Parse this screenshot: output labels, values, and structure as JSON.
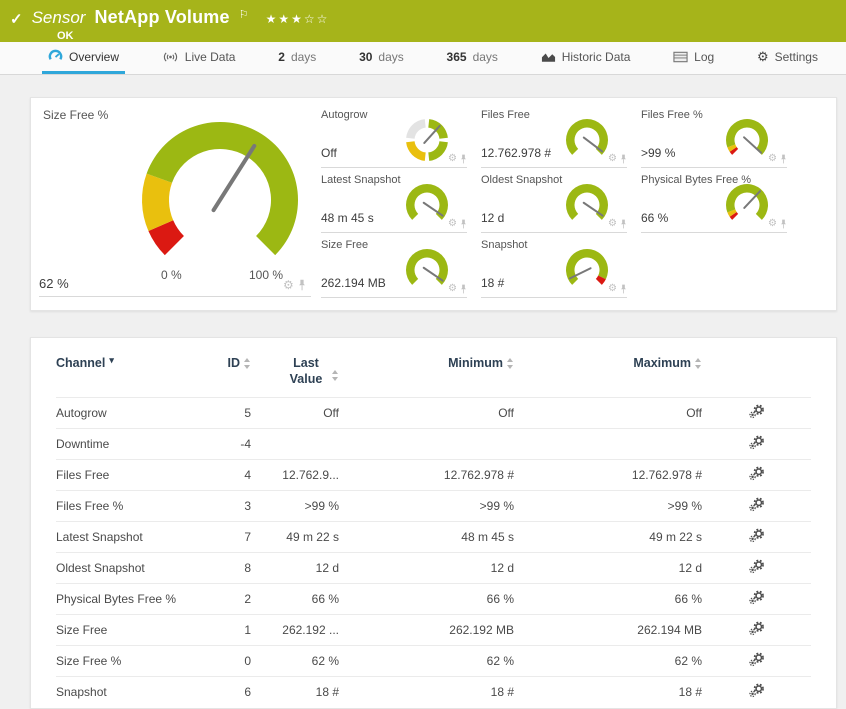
{
  "header": {
    "kind_label": "Sensor",
    "title": "NetApp Volume",
    "status": "OK",
    "stars": "★★★☆☆",
    "colors": {
      "header_bg": "#a6b41a"
    }
  },
  "icons": {
    "check": "✓",
    "flag": "⚐",
    "gear": "⚙",
    "caret_down": "▾"
  },
  "tabs": [
    {
      "label": "Overview",
      "active": true
    },
    {
      "label": "Live Data"
    },
    {
      "num": "2",
      "word": "days"
    },
    {
      "num": "30",
      "word": "days"
    },
    {
      "num": "365",
      "word": "days"
    },
    {
      "label": "Historic Data"
    },
    {
      "label": "Log"
    },
    {
      "label": "Settings"
    }
  ],
  "colors": {
    "gauge_green": "#9cb813",
    "gauge_yellow": "#e9c00e",
    "gauge_red": "#db1912",
    "active_tab_blue": "#2fa7da",
    "table_header_text": "#2e4154"
  },
  "chart_data": {
    "type": "gauges",
    "main_gauge": {
      "label": "Size Free %",
      "value": "62 %",
      "scale_min": "0 %",
      "scale_max": "100 %",
      "percent": 62,
      "segments": [
        {
          "from": 0,
          "to": 8,
          "color": "#db1912"
        },
        {
          "from": 8,
          "to": 24,
          "color": "#e9c00e"
        },
        {
          "from": 24,
          "to": 100,
          "color": "#9cb813"
        }
      ]
    },
    "tiles": [
      {
        "label": "Autogrow",
        "value": "Off",
        "gauge": {
          "needle_deg": 48,
          "deg_segments": [
            {
              "a1": 174,
              "a2": 96,
              "color": "#e3e3e3"
            },
            {
              "a1": 264,
              "a2": 186,
              "color": "#e9c00e"
            },
            {
              "a1": 354,
              "a2": 276,
              "color": "#9cb813"
            },
            {
              "a1": 84,
              "a2": 6,
              "color": "#9cb813"
            }
          ]
        }
      },
      {
        "label": "Files Free",
        "value": "12.762.978 #",
        "gauge": {
          "percent": 97,
          "segments": [
            {
              "from": 0,
              "to": 100,
              "color": "#9cb813"
            }
          ]
        }
      },
      {
        "label": "Files Free %",
        "value": ">99 %",
        "gauge": {
          "percent": 99,
          "segments": [
            {
              "from": 0,
              "to": 4,
              "color": "#db1912"
            },
            {
              "from": 4,
              "to": 9,
              "color": "#e9c00e"
            },
            {
              "from": 9,
              "to": 100,
              "color": "#9cb813"
            }
          ]
        }
      },
      {
        "label": "Latest Snapshot",
        "value": "48 m 45 s",
        "gauge": {
          "percent": 96,
          "segments": [
            {
              "from": 0,
              "to": 100,
              "color": "#9cb813"
            }
          ]
        }
      },
      {
        "label": "Oldest Snapshot",
        "value": "12 d",
        "gauge": {
          "percent": 96,
          "segments": [
            {
              "from": 0,
              "to": 100,
              "color": "#9cb813"
            }
          ]
        }
      },
      {
        "label": "Physical Bytes Free %",
        "value": "66 %",
        "gauge": {
          "percent": 66,
          "segments": [
            {
              "from": 0,
              "to": 4,
              "color": "#db1912"
            },
            {
              "from": 4,
              "to": 9,
              "color": "#e9c00e"
            },
            {
              "from": 9,
              "to": 100,
              "color": "#9cb813"
            }
          ]
        }
      },
      {
        "label": "Size Free",
        "value": "262.194 MB",
        "gauge": {
          "percent": 96,
          "segments": [
            {
              "from": 0,
              "to": 100,
              "color": "#9cb813"
            }
          ]
        }
      },
      {
        "label": "Snapshot",
        "value": "18 #",
        "gauge": {
          "percent": 7,
          "segments": [
            {
              "from": 0,
              "to": 93,
              "color": "#9cb813"
            },
            {
              "from": 93,
              "to": 100,
              "color": "#db1912"
            }
          ]
        }
      }
    ]
  },
  "table": {
    "columns": [
      "Channel",
      "ID",
      "Last Value",
      "Minimum",
      "Maximum"
    ],
    "rows": [
      {
        "channel": "Autogrow",
        "id": "5",
        "last": "Off",
        "min": "Off",
        "max": "Off"
      },
      {
        "channel": "Downtime",
        "id": "-4",
        "last": "",
        "min": "",
        "max": ""
      },
      {
        "channel": "Files Free",
        "id": "4",
        "last": "12.762.9...",
        "min": "12.762.978 #",
        "max": "12.762.978 #"
      },
      {
        "channel": "Files Free %",
        "id": "3",
        "last": ">99 %",
        "min": ">99 %",
        "max": ">99 %"
      },
      {
        "channel": "Latest Snapshot",
        "id": "7",
        "last": "49 m 22 s",
        "min": "48 m 45 s",
        "max": "49 m 22 s"
      },
      {
        "channel": "Oldest Snapshot",
        "id": "8",
        "last": "12 d",
        "min": "12 d",
        "max": "12 d"
      },
      {
        "channel": "Physical Bytes Free %",
        "id": "2",
        "last": "66 %",
        "min": "66 %",
        "max": "66 %"
      },
      {
        "channel": "Size Free",
        "id": "1",
        "last": "262.192 ...",
        "min": "262.192 MB",
        "max": "262.194 MB"
      },
      {
        "channel": "Size Free %",
        "id": "0",
        "last": "62 %",
        "min": "62 %",
        "max": "62 %"
      },
      {
        "channel": "Snapshot",
        "id": "6",
        "last": "18 #",
        "min": "18 #",
        "max": "18 #"
      }
    ]
  }
}
